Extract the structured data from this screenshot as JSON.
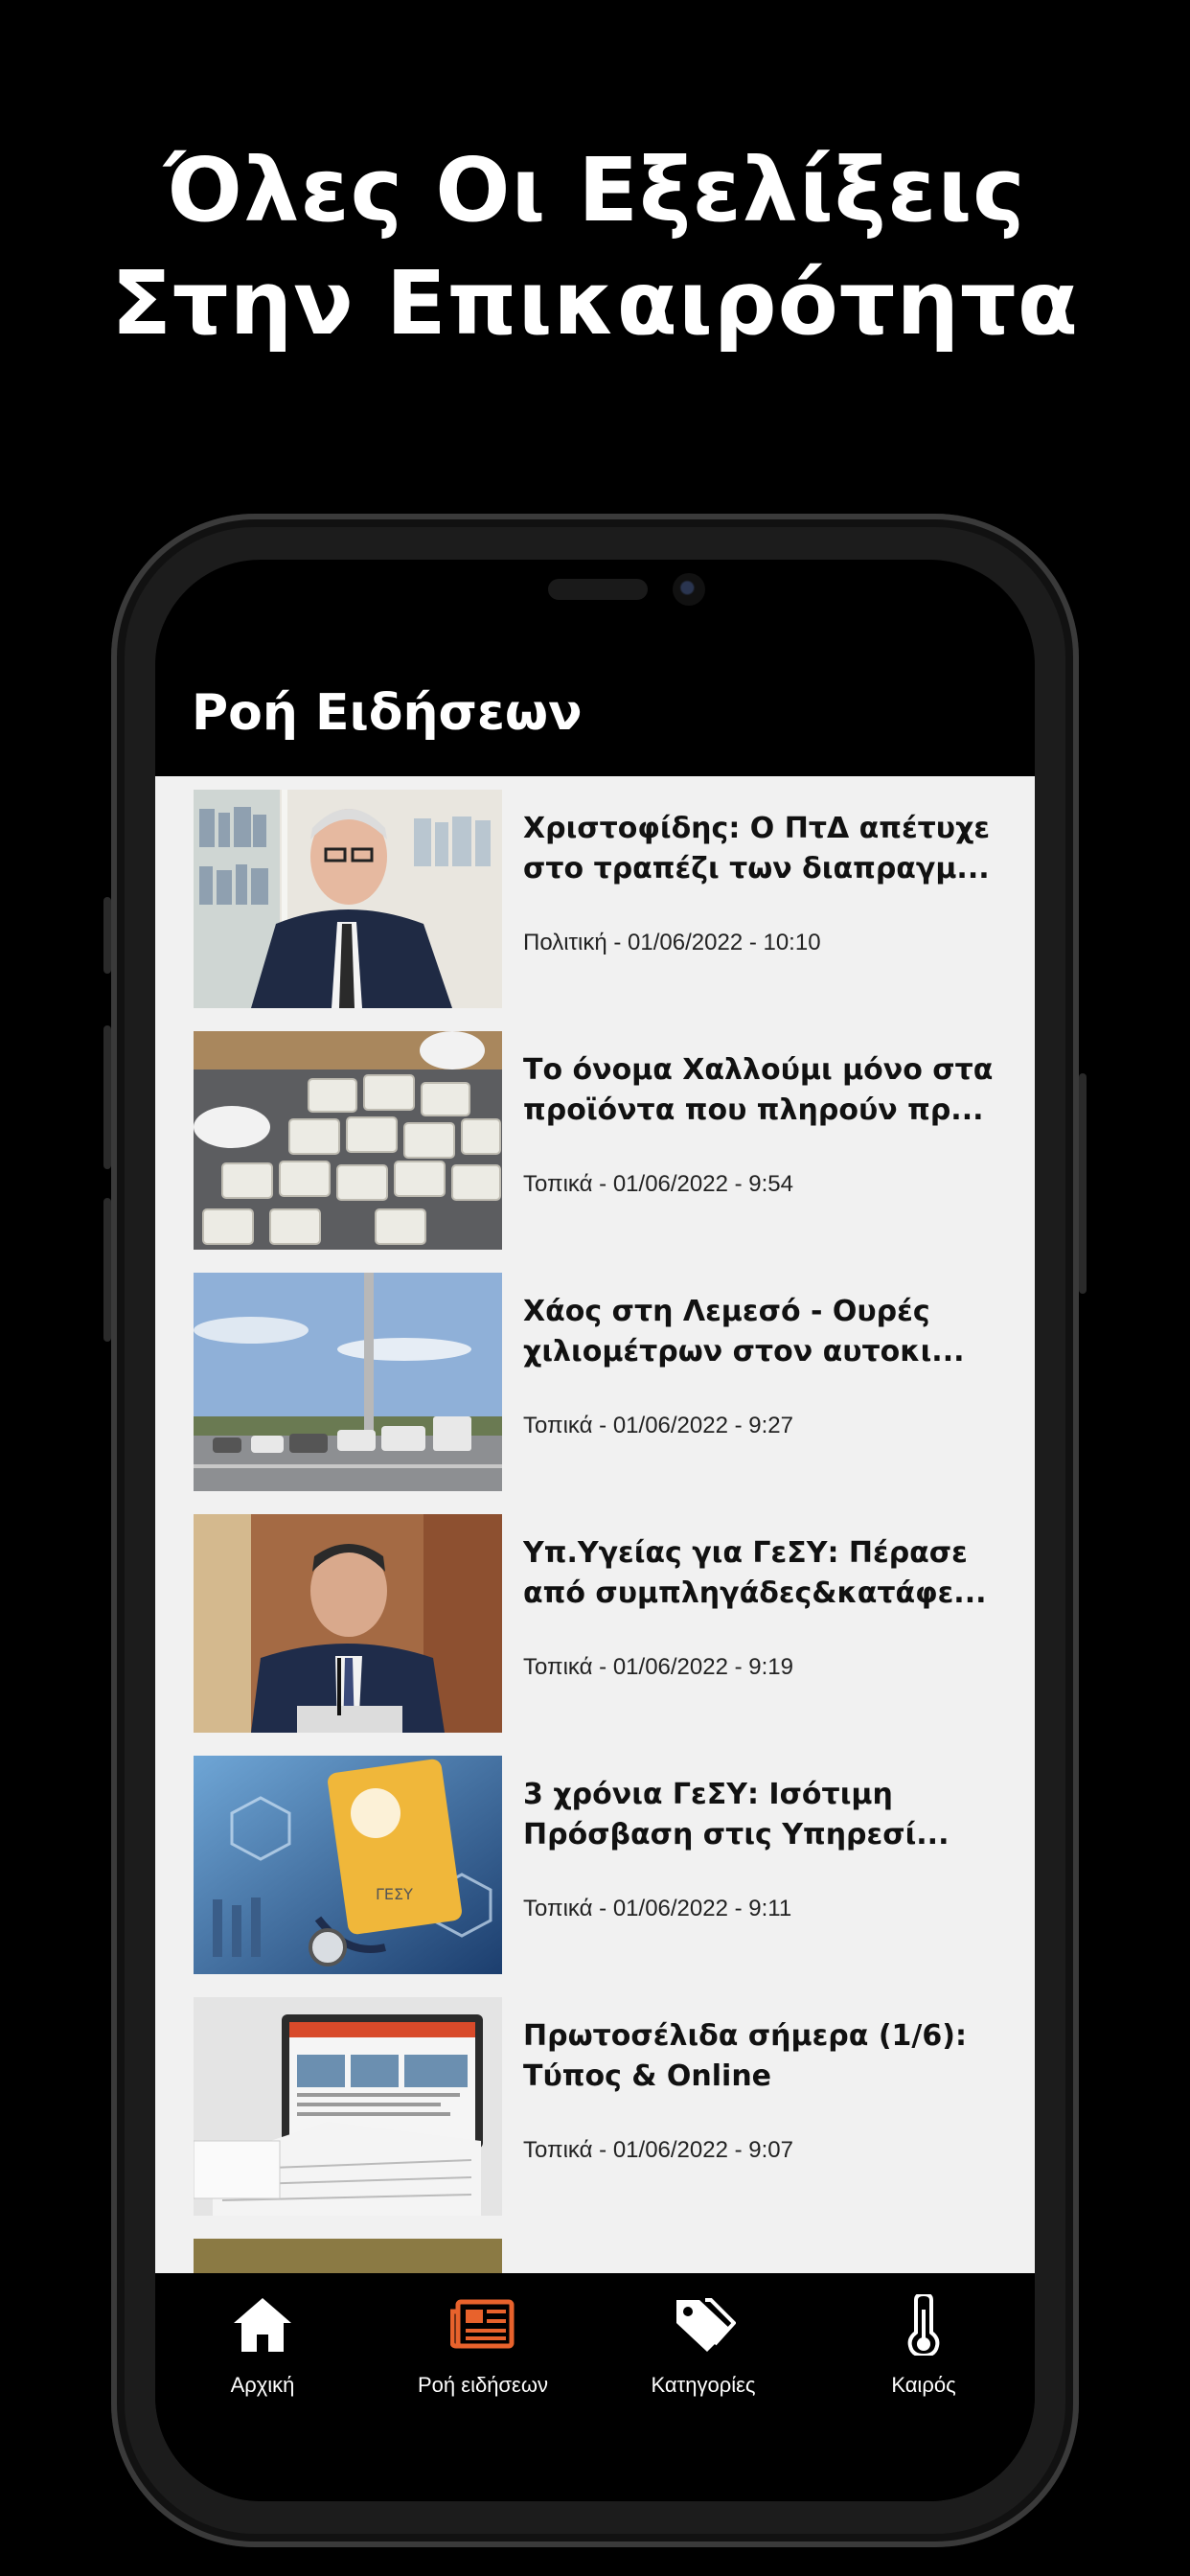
{
  "headline": {
    "line1": "Όλες Οι Εξελίξεις",
    "line2": "Στην Επικαιρότητα"
  },
  "app": {
    "title": "Ροή Ειδήσεων"
  },
  "articles": [
    {
      "title_line1": "Χριστοφίδης: Ο ΠτΔ απέτυχε",
      "title_line2": "στο τραπέζι των διαπραγμ...",
      "meta": "Πολιτική - 01/06/2022 - 10:10"
    },
    {
      "title_line1": "Το όνομα Χαλλούμι μόνο στα",
      "title_line2": "προϊόντα που πληρούν πρ...",
      "meta": "Τοπικά - 01/06/2022 - 9:54"
    },
    {
      "title_line1": "Χάος στη Λεμεσό - Ουρές",
      "title_line2": "χιλιομέτρων στον αυτοκι...",
      "meta": "Τοπικά - 01/06/2022 - 9:27"
    },
    {
      "title_line1": "Υπ.Υγείας για ΓεΣΥ: Πέρασε",
      "title_line2": "από συμπληγάδες&κατάφε...",
      "meta": "Τοπικά - 01/06/2022 - 9:19"
    },
    {
      "title_line1": "3 χρόνια ΓεΣΥ: Ισότιμη",
      "title_line2": "Πρόσβαση στις Υπηρεσί...",
      "meta": "Τοπικά - 01/06/2022 - 9:11"
    },
    {
      "title_line1": "Πρωτοσέλιδα σήμερα (1/6):",
      "title_line2": "Τύπος & Online",
      "meta": "Τοπικά - 01/06/2022 - 9:07"
    }
  ],
  "gesy_label": "ΓΕΣΥ",
  "tabs": [
    {
      "label": "Αρχική",
      "icon": "home-icon",
      "active": false
    },
    {
      "label": "Ροή ειδήσεων",
      "icon": "newspaper-icon",
      "active": true
    },
    {
      "label": "Κατηγορίες",
      "icon": "tags-icon",
      "active": false
    },
    {
      "label": "Καιρός",
      "icon": "thermometer-icon",
      "active": false
    }
  ],
  "colors": {
    "background": "#000000",
    "list_background": "#f1f1f1",
    "active_tab": "#e8622c",
    "text": "#111111"
  }
}
